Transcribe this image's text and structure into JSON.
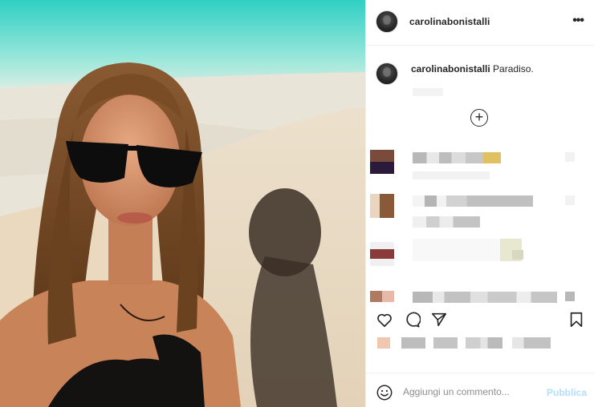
{
  "post": {
    "image_alt": "Selfie on a beach lounger with sea and sand behind",
    "header": {
      "username": "carolinabonistalli",
      "more_icon": "more-horizontal-icon",
      "more_label": "•••"
    },
    "caption": {
      "username": "carolinabonistalli",
      "text": "Paradiso."
    },
    "load_more_icon": "plus-circle-icon",
    "actions": {
      "like_icon": "heart-icon",
      "comment_icon": "comment-bubble-icon",
      "share_icon": "paper-plane-icon",
      "save_icon": "bookmark-icon"
    },
    "comment_box": {
      "emoji_icon": "smiley-icon",
      "placeholder": "Aggiungi un commento...",
      "publish_label": "Pubblica"
    }
  },
  "colors": {
    "text": "#262626",
    "muted": "#8e8e8e",
    "publish_disabled": "#b2dffc",
    "border": "#efefef"
  }
}
